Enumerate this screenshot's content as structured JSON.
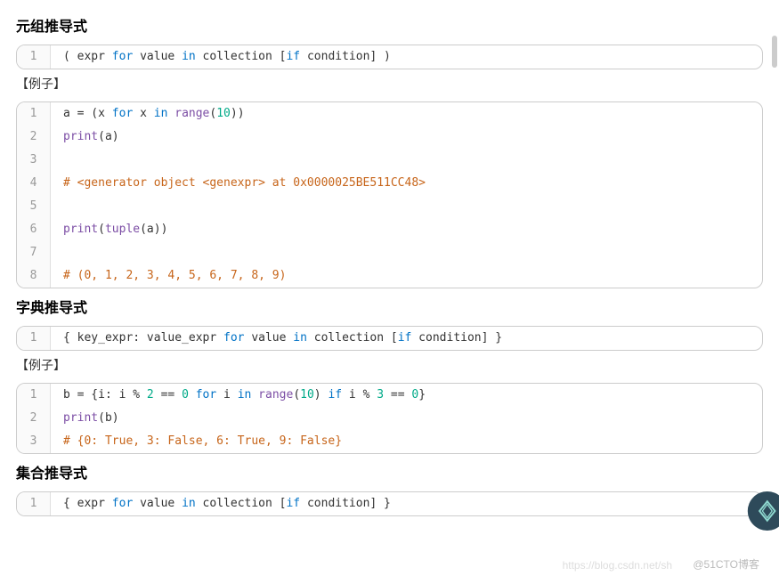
{
  "sections": [
    {
      "heading": "元组推导式",
      "syntax": {
        "tokens": [
          {
            "t": "( ",
            "c": ""
          },
          {
            "t": "expr ",
            "c": ""
          },
          {
            "t": "for",
            "c": "kw"
          },
          {
            "t": " value ",
            "c": ""
          },
          {
            "t": "in",
            "c": "kw"
          },
          {
            "t": " collection [",
            "c": ""
          },
          {
            "t": "if",
            "c": "kw"
          },
          {
            "t": " condition] )",
            "c": ""
          }
        ]
      },
      "example_label": "【例子】",
      "example": [
        [
          {
            "t": "a = (x ",
            "c": ""
          },
          {
            "t": "for",
            "c": "kw"
          },
          {
            "t": " x ",
            "c": ""
          },
          {
            "t": "in",
            "c": "kw"
          },
          {
            "t": " ",
            "c": ""
          },
          {
            "t": "range",
            "c": "builtin"
          },
          {
            "t": "(",
            "c": ""
          },
          {
            "t": "10",
            "c": "num"
          },
          {
            "t": "))",
            "c": ""
          }
        ],
        [
          {
            "t": "print",
            "c": "builtin"
          },
          {
            "t": "(a)",
            "c": ""
          }
        ],
        [],
        [
          {
            "t": "# <generator object <genexpr> at 0x0000025BE511CC48>",
            "c": "comment"
          }
        ],
        [],
        [
          {
            "t": "print",
            "c": "builtin"
          },
          {
            "t": "(",
            "c": ""
          },
          {
            "t": "tuple",
            "c": "builtin"
          },
          {
            "t": "(a))",
            "c": ""
          }
        ],
        [],
        [
          {
            "t": "# (0, 1, 2, 3, 4, 5, 6, 7, 8, 9)",
            "c": "comment"
          }
        ]
      ]
    },
    {
      "heading": "字典推导式",
      "syntax": {
        "tokens": [
          {
            "t": "{ key_expr: value_expr ",
            "c": ""
          },
          {
            "t": "for",
            "c": "kw"
          },
          {
            "t": " value ",
            "c": ""
          },
          {
            "t": "in",
            "c": "kw"
          },
          {
            "t": " collection [",
            "c": ""
          },
          {
            "t": "if",
            "c": "kw"
          },
          {
            "t": " condition] }",
            "c": ""
          }
        ]
      },
      "example_label": "【例子】",
      "example": [
        [
          {
            "t": "b = {i: i % ",
            "c": ""
          },
          {
            "t": "2",
            "c": "num"
          },
          {
            "t": " == ",
            "c": ""
          },
          {
            "t": "0",
            "c": "num"
          },
          {
            "t": " ",
            "c": ""
          },
          {
            "t": "for",
            "c": "kw"
          },
          {
            "t": " i ",
            "c": ""
          },
          {
            "t": "in",
            "c": "kw"
          },
          {
            "t": " ",
            "c": ""
          },
          {
            "t": "range",
            "c": "builtin"
          },
          {
            "t": "(",
            "c": ""
          },
          {
            "t": "10",
            "c": "num"
          },
          {
            "t": ") ",
            "c": ""
          },
          {
            "t": "if",
            "c": "kw"
          },
          {
            "t": " i % ",
            "c": ""
          },
          {
            "t": "3",
            "c": "num"
          },
          {
            "t": " == ",
            "c": ""
          },
          {
            "t": "0",
            "c": "num"
          },
          {
            "t": "}",
            "c": ""
          }
        ],
        [
          {
            "t": "print",
            "c": "builtin"
          },
          {
            "t": "(b)",
            "c": ""
          }
        ],
        [
          {
            "t": "# {0: True, 3: False, 6: True, 9: False}",
            "c": "comment"
          }
        ]
      ]
    },
    {
      "heading": "集合推导式",
      "syntax": {
        "tokens": [
          {
            "t": "{ expr ",
            "c": ""
          },
          {
            "t": "for",
            "c": "kw"
          },
          {
            "t": " value ",
            "c": ""
          },
          {
            "t": "in",
            "c": "kw"
          },
          {
            "t": " collection [",
            "c": ""
          },
          {
            "t": "if",
            "c": "kw"
          },
          {
            "t": " condition] }",
            "c": ""
          }
        ]
      },
      "example_label": null,
      "example": null
    }
  ],
  "watermark_left": "https://blog.csdn.net/sh",
  "watermark_right": "@51CTO博客"
}
